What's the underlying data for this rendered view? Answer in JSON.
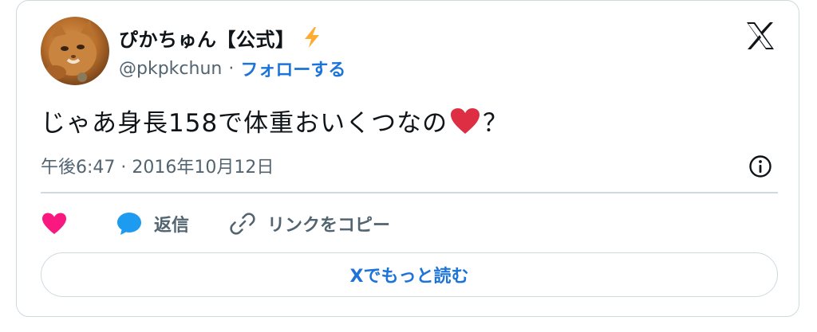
{
  "author": {
    "display_name": "ぴかちゅん【公式】",
    "handle": "@pkpkchun",
    "separator": "·",
    "follow_label": "フォローする",
    "badge_icon": "lightning-bolt-icon"
  },
  "tweet": {
    "text_before_emoji": "じゃあ身長158で体重おいくつなの",
    "emoji_icon": "red-heart-icon",
    "text_after_emoji": "？",
    "timestamp": "午後6:47 · 2016年10月12日"
  },
  "actions": {
    "like_icon": "heart-icon",
    "reply_label": "返信",
    "copy_link_label": "リンクをコピー"
  },
  "read_more_label": "Xでもっと読む",
  "colors": {
    "accent_blue": "#1d74d8",
    "like_pink": "#f91880",
    "reply_blue": "#1d9bf0",
    "muted_gray": "#536471",
    "border": "#cfd9de",
    "heart_red": "#dd2e44",
    "bolt_yellow": "#ffac33"
  }
}
